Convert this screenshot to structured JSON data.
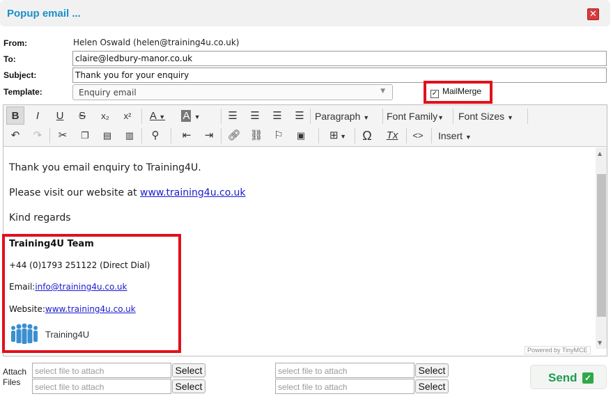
{
  "window": {
    "title": "Popup email ...",
    "close_icon": "close-icon"
  },
  "form": {
    "from_label": "From:",
    "from_value": "Helen Oswald  (helen@training4u.co.uk)",
    "to_label": "To:",
    "to_value": "claire@ledbury-manor.co.uk",
    "subject_label": "Subject:",
    "subject_value": "Thank you for your enquiry",
    "template_label": "Template:",
    "template_value": "Enquiry email",
    "mailmerge_label": "MailMerge",
    "mailmerge_checked": true
  },
  "toolbar": {
    "paragraph": "Paragraph",
    "font_family": "Font Family",
    "font_sizes": "Font Sizes",
    "insert": "Insert",
    "bold": "B",
    "italic": "I",
    "underline": "U",
    "strike": "S",
    "subscript": "x₂",
    "superscript": "x²",
    "text_color": "A",
    "bg_color": "A",
    "omega": "Ω",
    "clear_format": "Tx",
    "code": "<>"
  },
  "body": {
    "line1": "Thank you email enquiry to Training4U.",
    "line2_prefix": "Please visit our website at ",
    "line2_link": "www.training4u.co.uk",
    "line3": "Kind regards"
  },
  "signature": {
    "team": "Training4U Team",
    "phone": "+44 (0)1793 251122 (Direct Dial)",
    "email_label": "Email:",
    "email": "info@training4u.co.uk",
    "website_label": "Website:",
    "website": "www.training4u.co.uk",
    "logo_text": "Training4U"
  },
  "editor": {
    "powered_by": "Powered by TinyMCE"
  },
  "attach": {
    "label_line1": "Attach",
    "label_line2": "Files",
    "placeholder": "select file to attach",
    "select_label": "Select"
  },
  "send": {
    "label": "Send"
  },
  "colors": {
    "accent": "#1a8fc8",
    "highlight": "#e1111b",
    "send": "#1e9a52"
  }
}
